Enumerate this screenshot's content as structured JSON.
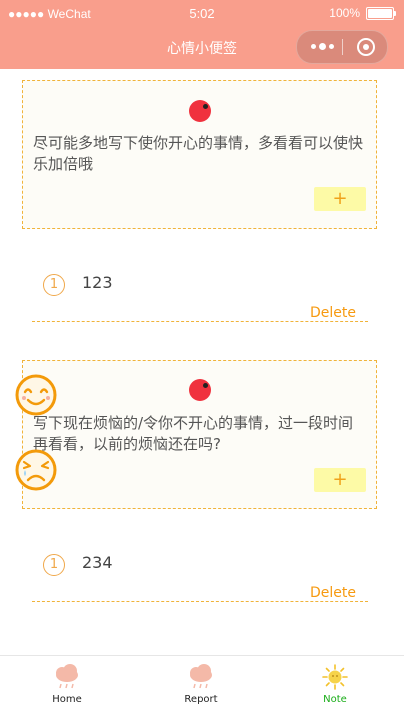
{
  "status_bar": {
    "carrier": "●●●●● WeChat",
    "time": "5:02",
    "battery": "100%"
  },
  "nav": {
    "title": "心情小便签"
  },
  "happy": {
    "prompt": "尽可能多地写下使你开心的事情，多看看可以使快乐加倍哦",
    "add_label": "+",
    "items": [
      {
        "index": "1",
        "text": "123",
        "delete_label": "Delete"
      }
    ]
  },
  "unhappy": {
    "prompt": "写下现在烦恼的/令你不开心的事情，过一段时间再看看，以前的烦恼还在吗?",
    "add_label": "+",
    "items": [
      {
        "index": "1",
        "text": "234",
        "delete_label": "Delete"
      }
    ]
  },
  "tabs": [
    {
      "label": "Home",
      "icon": "rain-cloud-icon",
      "active": false
    },
    {
      "label": "Report",
      "icon": "rain-cloud-icon",
      "active": false
    },
    {
      "label": "Note",
      "icon": "sun-icon",
      "active": true
    }
  ],
  "colors": {
    "nav_bg": "#f99e8c",
    "accent": "#f0a21a",
    "active_tab": "#1aad19",
    "dot": "#f0323e"
  }
}
